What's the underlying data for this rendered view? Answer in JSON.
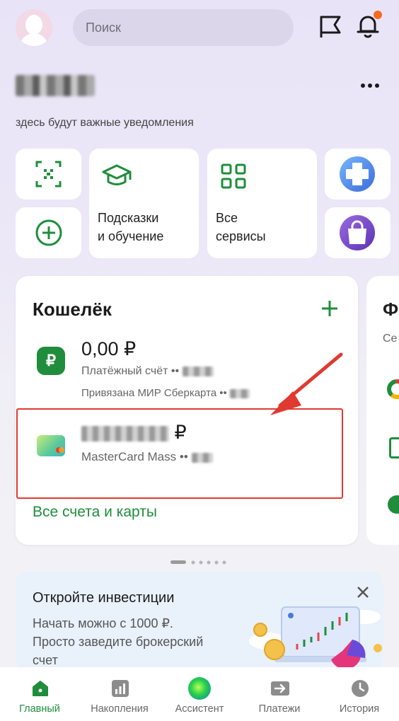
{
  "header": {
    "search_placeholder": "Поиск"
  },
  "notifications_text": "здесь будут важные уведомления",
  "tiles": {
    "tips": {
      "line1": "Подсказки",
      "line2": "и обучение"
    },
    "all_services": {
      "line1": "Все",
      "line2": "сервисы"
    }
  },
  "wallet": {
    "title": "Кошелёк",
    "account": {
      "balance": "0,00 ₽",
      "subtitle": "Платёжный счёт ••",
      "linked": "Привязана МИР Сберкарта ••"
    },
    "card": {
      "currency": "₽",
      "name": "MasterCard Mass ••"
    },
    "all_accounts_link": "Все счета и карты"
  },
  "second_card": {
    "title": "Ф",
    "subtitle": "Се"
  },
  "invest_banner": {
    "title": "Откройте инвестиции",
    "line1": "Начать можно с 1000 ₽.",
    "line2": "Просто заведите брокерский",
    "line3": "счет"
  },
  "bottom_nav": {
    "home": "Главный",
    "savings": "Накопления",
    "assistant": "Ассистент",
    "payments": "Платежи",
    "history": "История"
  },
  "colors": {
    "brand_green": "#1f8d3c",
    "annotation_red": "#e03a30",
    "notification_dot": "#f26b21"
  }
}
